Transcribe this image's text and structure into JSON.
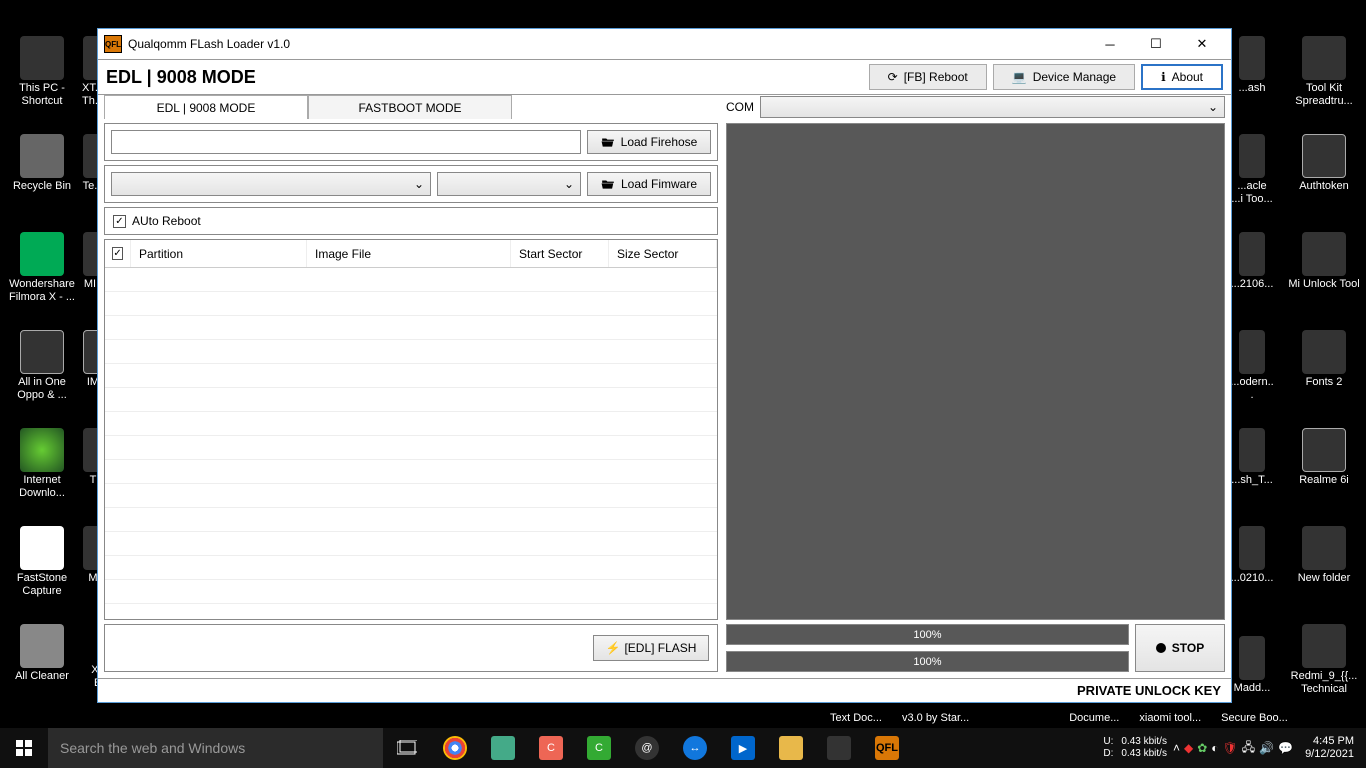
{
  "window": {
    "title": "Qualqomm FLash Loader v1.0",
    "app_icon_text": "QFL",
    "header_mode": "EDL | 9008 MODE",
    "buttons": {
      "reboot": "[FB] Reboot",
      "device_manage": "Device Manage",
      "about": "About"
    },
    "tabs": {
      "edl": "EDL | 9008 MODE",
      "fastboot": "FASTBOOT MODE"
    },
    "load_firehose": "Load Firehose",
    "load_firmware": "Load Fimware",
    "auto_reboot": "AUto Reboot",
    "columns": {
      "partition": "Partition",
      "image": "Image File",
      "start": "Start Sector",
      "size": "Size Sector"
    },
    "flash_btn": "[EDL] FLASH",
    "com_label": "COM",
    "progress1": "100%",
    "progress2": "100%",
    "stop": "STOP",
    "footer": "PRIVATE UNLOCK KEY"
  },
  "desktop": {
    "left_col": [
      "This PC - Shortcut",
      "Recycle Bin",
      "Wondershare Filmora X - ...",
      "All in One Oppo & ...",
      "Internet Downlo...",
      "FastStone Capture",
      "All Cleaner"
    ],
    "left2": [
      "XT... Th...",
      "Te...",
      "MI..",
      "IM",
      "T",
      "M",
      "Xiaomi Exp..."
    ],
    "right1": [
      "...ash",
      "...acle ...i Too...",
      "...2106...",
      "...odern...",
      "...sh_T...",
      "...0210...",
      "Madd..."
    ],
    "right2": [
      "Tool Kit Spreadtru...",
      "Authtoken",
      "Mi Unlock Tool",
      "Fonts 2",
      "Realme 6i",
      "New folder",
      "Redmi_9_{{... Technical"
    ]
  },
  "taskbar": {
    "search_placeholder": "Search the web and Windows",
    "truncated": [
      "Text Doc...",
      "v3.0 by Star...",
      "Docume...",
      "xiaomi tool...",
      "Secure Boo..."
    ],
    "net": {
      "u": "U:",
      "d": "D:",
      "u_val": "0.43 kbit/s",
      "d_val": "0.43 kbit/s"
    },
    "time": "4:45 PM",
    "date": "9/12/2021"
  }
}
